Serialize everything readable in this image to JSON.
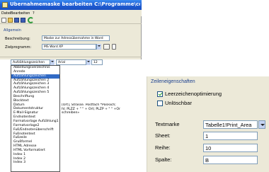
{
  "window": {
    "title": "Übernahmemaske bearbeiten   C:\\Programme\\com",
    "menu": [
      "Datei",
      "Bearbeiten",
      "?"
    ]
  },
  "toolbar": {
    "icons": [
      "new-file-icon",
      "open-folder-icon",
      "save-icon",
      "save-as-icon",
      "refresh-icon"
    ]
  },
  "general": {
    "group_title": "Allgemein",
    "description_label": "Beschreibung:",
    "description_value": "Maske zur Adressübernahme in Word",
    "target_label": "Zielprogramm:",
    "target_value": "MS Word XP"
  },
  "editor": {
    "style_value": "Aufzählungszeichen",
    "font_value": "Arial",
    "size_value": "12",
    "dropdown_items": [
      "Abbildungsverzeichnis",
      "Anrede",
      "Aufzählungszeichen",
      "Aufzählungszeichen 2",
      "Aufzählungszeichen 3",
      "Aufzählungszeichen 4",
      "Aufzählungszeichen 5",
      "Beschriftung",
      "Blocktext",
      "Datum",
      "Dokumentstruktur",
      "E-Mail-Signatur",
      "Endnotentext",
      "Formatvorlage Aufzählung1 +",
      "Formatvorlage2",
      "Fuß/Endnotenüberschrift",
      "Fußnotentext",
      "Fußzeile",
      "Grußformel",
      "HTML Adresse",
      "HTML Vorformatiert",
      "Index 1",
      "Index 2",
      "Index 3"
    ],
    "selected_item": "Aufzählungszeichen",
    "code_lines": [
      "[Ort], Strasse. Postfach *PosFach;",
      "hl; PLZZ + \" \" + Ort; PLZP + \" \" +Or",
      "schreiben»"
    ]
  },
  "row_props": {
    "title": "Zeileneigenschaften",
    "checkbox1_label": "Leerzeichenoptimierung",
    "checkbox1_checked": true,
    "checkbox2_label": "Unlöschbar",
    "checkbox2_checked": false,
    "textmarke_label": "Textmarke",
    "textmarke_value": "Tabelle1!Print_Area",
    "sheet_label": "Sheet:",
    "sheet_value": "1",
    "reihe_label": "Reihe:",
    "reihe_value": "10",
    "spalte_label": "Spalte:",
    "spalte_value": "B"
  },
  "colors": {
    "titlebar": "#1f5fd6",
    "selection": "#316ac5",
    "group_title": "#1a3f8f"
  }
}
